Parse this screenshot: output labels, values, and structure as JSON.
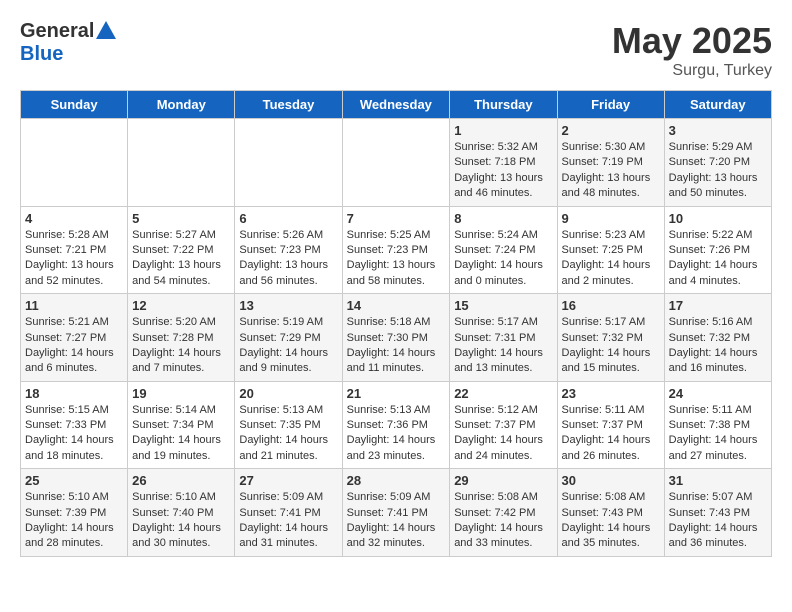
{
  "header": {
    "logo_general": "General",
    "logo_blue": "Blue",
    "month_year": "May 2025",
    "location": "Surgu, Turkey"
  },
  "days_of_week": [
    "Sunday",
    "Monday",
    "Tuesday",
    "Wednesday",
    "Thursday",
    "Friday",
    "Saturday"
  ],
  "weeks": [
    [
      {
        "day": "",
        "content": ""
      },
      {
        "day": "",
        "content": ""
      },
      {
        "day": "",
        "content": ""
      },
      {
        "day": "",
        "content": ""
      },
      {
        "day": "1",
        "content": "Sunrise: 5:32 AM\nSunset: 7:18 PM\nDaylight: 13 hours\nand 46 minutes."
      },
      {
        "day": "2",
        "content": "Sunrise: 5:30 AM\nSunset: 7:19 PM\nDaylight: 13 hours\nand 48 minutes."
      },
      {
        "day": "3",
        "content": "Sunrise: 5:29 AM\nSunset: 7:20 PM\nDaylight: 13 hours\nand 50 minutes."
      }
    ],
    [
      {
        "day": "4",
        "content": "Sunrise: 5:28 AM\nSunset: 7:21 PM\nDaylight: 13 hours\nand 52 minutes."
      },
      {
        "day": "5",
        "content": "Sunrise: 5:27 AM\nSunset: 7:22 PM\nDaylight: 13 hours\nand 54 minutes."
      },
      {
        "day": "6",
        "content": "Sunrise: 5:26 AM\nSunset: 7:23 PM\nDaylight: 13 hours\nand 56 minutes."
      },
      {
        "day": "7",
        "content": "Sunrise: 5:25 AM\nSunset: 7:23 PM\nDaylight: 13 hours\nand 58 minutes."
      },
      {
        "day": "8",
        "content": "Sunrise: 5:24 AM\nSunset: 7:24 PM\nDaylight: 14 hours\nand 0 minutes."
      },
      {
        "day": "9",
        "content": "Sunrise: 5:23 AM\nSunset: 7:25 PM\nDaylight: 14 hours\nand 2 minutes."
      },
      {
        "day": "10",
        "content": "Sunrise: 5:22 AM\nSunset: 7:26 PM\nDaylight: 14 hours\nand 4 minutes."
      }
    ],
    [
      {
        "day": "11",
        "content": "Sunrise: 5:21 AM\nSunset: 7:27 PM\nDaylight: 14 hours\nand 6 minutes."
      },
      {
        "day": "12",
        "content": "Sunrise: 5:20 AM\nSunset: 7:28 PM\nDaylight: 14 hours\nand 7 minutes."
      },
      {
        "day": "13",
        "content": "Sunrise: 5:19 AM\nSunset: 7:29 PM\nDaylight: 14 hours\nand 9 minutes."
      },
      {
        "day": "14",
        "content": "Sunrise: 5:18 AM\nSunset: 7:30 PM\nDaylight: 14 hours\nand 11 minutes."
      },
      {
        "day": "15",
        "content": "Sunrise: 5:17 AM\nSunset: 7:31 PM\nDaylight: 14 hours\nand 13 minutes."
      },
      {
        "day": "16",
        "content": "Sunrise: 5:17 AM\nSunset: 7:32 PM\nDaylight: 14 hours\nand 15 minutes."
      },
      {
        "day": "17",
        "content": "Sunrise: 5:16 AM\nSunset: 7:32 PM\nDaylight: 14 hours\nand 16 minutes."
      }
    ],
    [
      {
        "day": "18",
        "content": "Sunrise: 5:15 AM\nSunset: 7:33 PM\nDaylight: 14 hours\nand 18 minutes."
      },
      {
        "day": "19",
        "content": "Sunrise: 5:14 AM\nSunset: 7:34 PM\nDaylight: 14 hours\nand 19 minutes."
      },
      {
        "day": "20",
        "content": "Sunrise: 5:13 AM\nSunset: 7:35 PM\nDaylight: 14 hours\nand 21 minutes."
      },
      {
        "day": "21",
        "content": "Sunrise: 5:13 AM\nSunset: 7:36 PM\nDaylight: 14 hours\nand 23 minutes."
      },
      {
        "day": "22",
        "content": "Sunrise: 5:12 AM\nSunset: 7:37 PM\nDaylight: 14 hours\nand 24 minutes."
      },
      {
        "day": "23",
        "content": "Sunrise: 5:11 AM\nSunset: 7:37 PM\nDaylight: 14 hours\nand 26 minutes."
      },
      {
        "day": "24",
        "content": "Sunrise: 5:11 AM\nSunset: 7:38 PM\nDaylight: 14 hours\nand 27 minutes."
      }
    ],
    [
      {
        "day": "25",
        "content": "Sunrise: 5:10 AM\nSunset: 7:39 PM\nDaylight: 14 hours\nand 28 minutes."
      },
      {
        "day": "26",
        "content": "Sunrise: 5:10 AM\nSunset: 7:40 PM\nDaylight: 14 hours\nand 30 minutes."
      },
      {
        "day": "27",
        "content": "Sunrise: 5:09 AM\nSunset: 7:41 PM\nDaylight: 14 hours\nand 31 minutes."
      },
      {
        "day": "28",
        "content": "Sunrise: 5:09 AM\nSunset: 7:41 PM\nDaylight: 14 hours\nand 32 minutes."
      },
      {
        "day": "29",
        "content": "Sunrise: 5:08 AM\nSunset: 7:42 PM\nDaylight: 14 hours\nand 33 minutes."
      },
      {
        "day": "30",
        "content": "Sunrise: 5:08 AM\nSunset: 7:43 PM\nDaylight: 14 hours\nand 35 minutes."
      },
      {
        "day": "31",
        "content": "Sunrise: 5:07 AM\nSunset: 7:43 PM\nDaylight: 14 hours\nand 36 minutes."
      }
    ]
  ]
}
